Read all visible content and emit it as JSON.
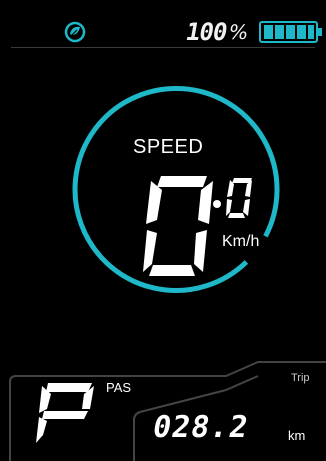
{
  "status_bar": {
    "battery_percent_text": "100",
    "percent_sign": "%",
    "battery_level": 1.0,
    "icons": [
      "eco-mode-icon",
      "battery-icon"
    ],
    "accent_color": "#1fb8c8"
  },
  "speedometer": {
    "label": "SPEED",
    "speed_integer": "0",
    "speed_decimal": "0",
    "unit": "Km/h"
  },
  "assist": {
    "mode_letter": "P",
    "label": "PAS"
  },
  "trip": {
    "label": "Trip",
    "value": "028.2",
    "unit": "km"
  }
}
